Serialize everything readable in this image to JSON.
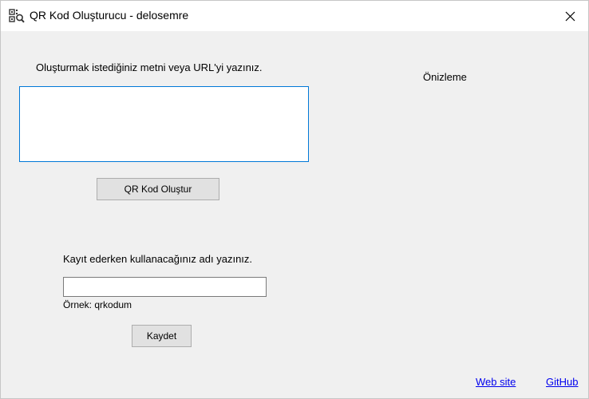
{
  "window": {
    "title": "QR Kod Oluşturucu - delosemre",
    "icon": "qr-search-icon",
    "close_icon": "close-icon"
  },
  "generate": {
    "prompt": "Oluşturmak istediğiniz metni veya URL'yi yazınız.",
    "text_value": "",
    "button_label": "QR Kod Oluştur"
  },
  "preview": {
    "label": "Önizleme"
  },
  "save": {
    "prompt": "Kayıt ederken kullanacağınız adı yazınız.",
    "name_value": "",
    "example": "Örnek: qrkodum",
    "button_label": "Kaydet"
  },
  "links": {
    "website": "Web site",
    "github": "GitHub"
  },
  "colors": {
    "focus_border": "#0078d7",
    "link": "#0000ee",
    "background": "#f0f0f0"
  }
}
